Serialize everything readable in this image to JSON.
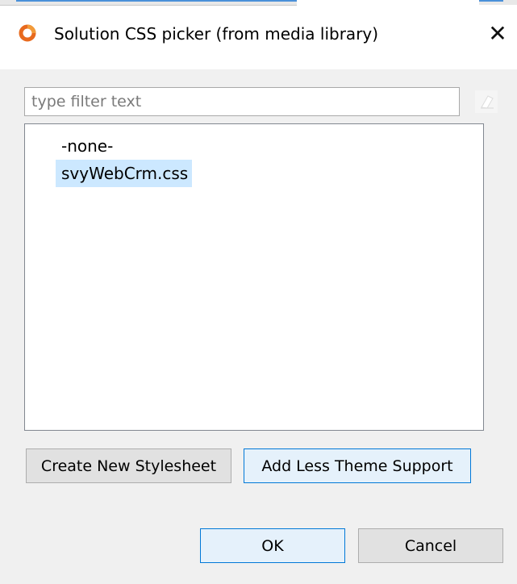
{
  "window": {
    "title": "Solution CSS picker (from media library)",
    "app_icon": "servoy-logo-icon",
    "close_symbol": "✕"
  },
  "filter": {
    "placeholder": "type filter text",
    "value": "",
    "clear_icon": "eraser-icon"
  },
  "list": {
    "items": [
      {
        "label": "-none-",
        "selected": false
      },
      {
        "label": "svyWebCrm.css",
        "selected": true
      }
    ]
  },
  "buttons": {
    "create_stylesheet": "Create New Stylesheet",
    "add_less_theme": "Add Less Theme Support",
    "ok": "OK",
    "cancel": "Cancel"
  },
  "colors": {
    "accent": "#e86a1e",
    "selection": "#cce8ff",
    "focus_border": "#0078d7"
  }
}
